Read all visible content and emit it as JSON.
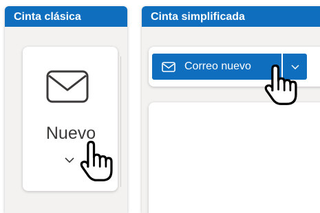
{
  "classic_ribbon": {
    "header_title": "Cinta clásica",
    "new_button_label": "Nuevo",
    "new_button_icon": "mail-icon",
    "dropdown_icon": "chevron-down-icon"
  },
  "simplified_ribbon": {
    "header_title": "Cinta simplificada",
    "new_mail_label": "Correo nuevo",
    "new_mail_icon": "mail-icon",
    "dropdown_icon": "chevron-down-icon"
  },
  "cursor_icon": "hand-pointer-icon",
  "colors": {
    "accent": "#106ebe",
    "panel_background": "#f3f2f1",
    "text": "#3b3a39"
  }
}
